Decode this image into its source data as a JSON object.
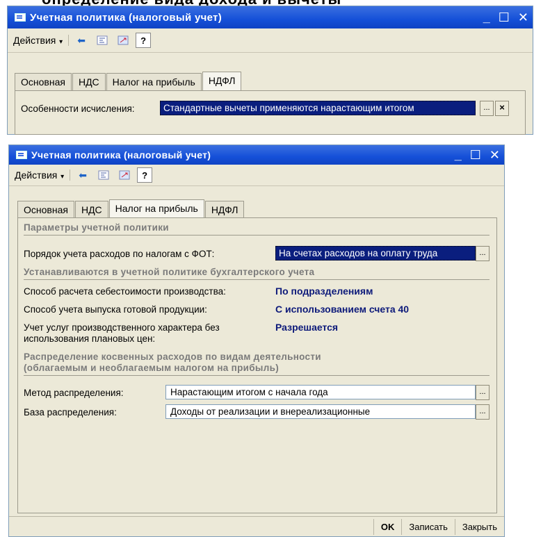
{
  "top_title": "определение вида дохода и вычеты",
  "window1": {
    "title": "Учетная политика (налоговый учет)",
    "toolbar": {
      "actions_label": "Действия",
      "help_label": "?"
    },
    "tabs": [
      "Основная",
      "НДС",
      "Налог на прибыль",
      "НДФЛ"
    ],
    "active_tab": "НДФЛ",
    "field": {
      "label": "Особенности исчисления:",
      "value": "Стандартные вычеты применяются нарастающим итогом",
      "ellipsis": "...",
      "clear": "×"
    }
  },
  "window2": {
    "title": "Учетная политика (налоговый учет)",
    "toolbar": {
      "actions_label": "Действия",
      "help_label": "?"
    },
    "tabs": [
      "Основная",
      "НДС",
      "Налог на прибыль",
      "НДФЛ"
    ],
    "active_tab": "Налог на прибыль",
    "section1": "Параметры учетной политики",
    "fot_label": "Порядок учета расходов по налогам с ФОТ:",
    "fot_value": "На счетах расходов на оплату труда",
    "section2": "Устанавливаются в учетной политике бухгалтерского учета",
    "cost_label": "Способ расчета себестоимости производства:",
    "cost_value": "По подразделениям",
    "output_label": "Способ учета выпуска готовой продукции:",
    "output_value": "С использованием счета 40",
    "services_label_1": "Учет услуг производственного характера без",
    "services_label_2": "использования плановых цен:",
    "services_value": "Разрешается",
    "section3_line1": "Распределение косвенных расходов по видам деятельности",
    "section3_line2": "(облагаемым и необлагаемым налогом на прибыль)",
    "method_label": "Метод распределения:",
    "method_value": "Нарастающим итогом с начала года",
    "base_label": "База распределения:",
    "base_value": "Доходы от реализации и внереализационные",
    "ellipsis": "...",
    "buttons": {
      "ok": "OK",
      "save": "Записать",
      "close": "Закрыть"
    }
  }
}
